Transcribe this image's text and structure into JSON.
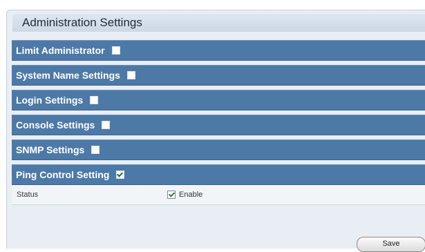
{
  "panel": {
    "title": "Administration Settings"
  },
  "sections": [
    {
      "label": "Limit Administrator",
      "checked": false
    },
    {
      "label": "System Name Settings",
      "checked": false
    },
    {
      "label": "Login Settings",
      "checked": false
    },
    {
      "label": "Console Settings",
      "checked": false
    },
    {
      "label": "SNMP Settings",
      "checked": false
    },
    {
      "label": "Ping Control Setting",
      "checked": true
    }
  ],
  "ping_control": {
    "status_label": "Status",
    "enable_label": "Enable",
    "enable_checked": true
  },
  "buttons": {
    "save_label": "Save"
  },
  "colors": {
    "section_bar": "#4d79a7",
    "panel_bg": "#e9eef4"
  }
}
